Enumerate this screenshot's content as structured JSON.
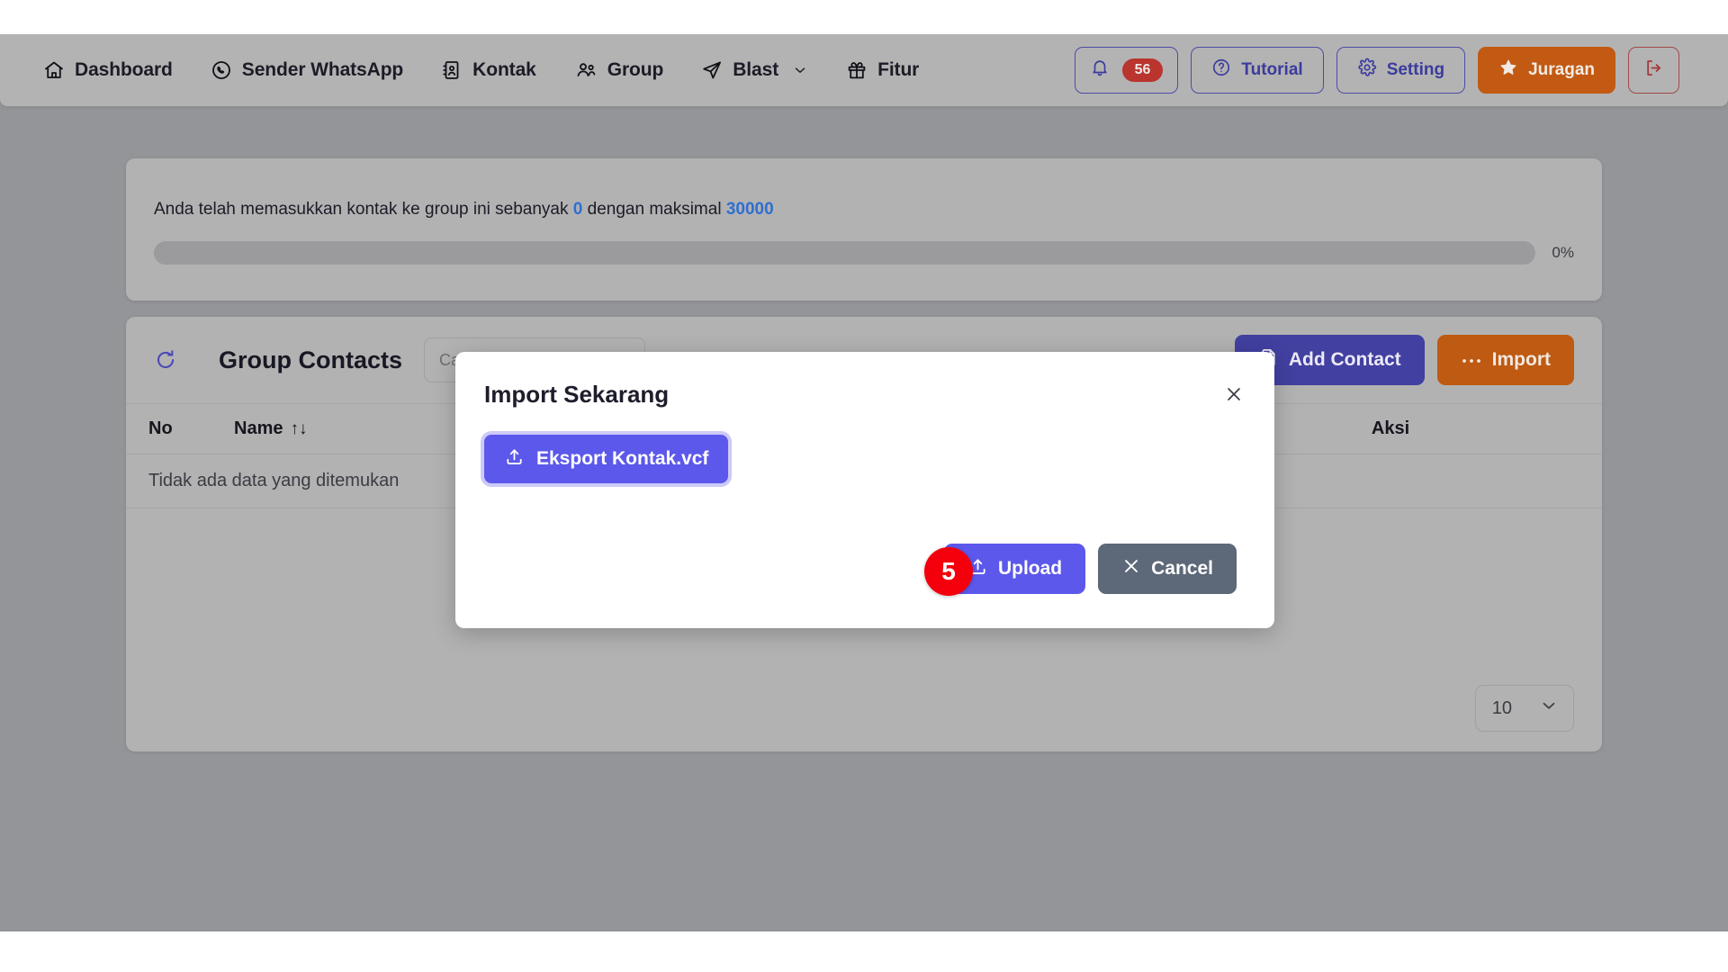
{
  "navbar": {
    "links": [
      {
        "label": "Dashboard",
        "icon": "home-icon"
      },
      {
        "label": "Sender WhatsApp",
        "icon": "whatsapp-icon"
      },
      {
        "label": "Kontak",
        "icon": "contact-book-icon"
      },
      {
        "label": "Group",
        "icon": "people-icon"
      },
      {
        "label": "Blast",
        "icon": "send-icon",
        "caret": true
      },
      {
        "label": "Fitur",
        "icon": "gift-icon"
      }
    ],
    "actions": {
      "notification_icon": "bell-icon",
      "notification_count": "56",
      "tutorial_label": "Tutorial",
      "tutorial_icon": "question-circle-icon",
      "setting_label": "Setting",
      "setting_icon": "gear-icon",
      "juragan_label": "Juragan",
      "juragan_icon": "star-icon",
      "logout_icon": "logout-icon"
    }
  },
  "quota": {
    "text_before": "Anda telah memasukkan kontak ke group ini sebanyak ",
    "current": "0",
    "text_middle": " dengan maksimal ",
    "maximum": "30000",
    "percent_label": "0%",
    "percent_value": 0
  },
  "contacts": {
    "refresh_icon": "refresh-icon",
    "title": "Group Contacts",
    "search_placeholder": "Cari...",
    "search_value": "",
    "add_contact_label": "Add Contact",
    "add_contact_icon": "file-plus-icon",
    "import_label": "Import",
    "import_icon": "ellipsis-icon",
    "columns": [
      "No",
      "Name",
      "",
      "",
      "Aksi"
    ],
    "name_sort_icon": "sort-updown-icon",
    "empty_message": "Tidak ada data yang ditemukan",
    "rows": [],
    "page_size": "10",
    "page_size_caret_icon": "chevron-down-icon"
  },
  "modal": {
    "title": "Import Sekarang",
    "close_icon": "close-icon",
    "file_button_label": "Eksport Kontak.vcf",
    "file_button_icon": "upload-icon",
    "upload_label": "Upload",
    "upload_icon": "upload-icon",
    "cancel_label": "Cancel",
    "cancel_icon": "x-icon"
  },
  "step_marker": {
    "number": "5"
  },
  "colors": {
    "indigo": "#4240a0",
    "orange": "#bf5a12",
    "modal_purple": "#5c58eb",
    "cancel_gray": "#5d6878",
    "badge_red": "#b9352e",
    "marker_red": "#f3000c",
    "link_blue": "#2f6fd0"
  }
}
